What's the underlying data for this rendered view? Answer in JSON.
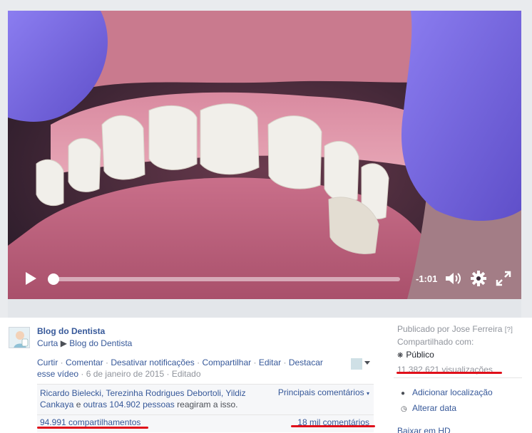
{
  "video": {
    "time_remaining": "-1:01",
    "progress": 0.0
  },
  "post": {
    "page_name": "Blog do Dentista",
    "curta": "Curta",
    "arrow": "▶",
    "curta_target": "Blog do Dentista",
    "actions": {
      "like": "Curtir",
      "comment": "Comentar",
      "disable_notifications": "Desativar notificações",
      "share": "Compartilhar",
      "edit": "Editar",
      "highlight": "Destacar esse vídeo",
      "date": "6 de janeiro de 2015",
      "edited": "Editado",
      "sep": " · "
    },
    "reactions": {
      "people": "Ricardo Bielecki, Terezinha Rodrigues Debortoli, Yildiz Cankaya",
      "and": " e ",
      "others": "outras 104.902 pessoas",
      "reacted": " reagiram a isso.",
      "top_comments": "Principais comentários",
      "shares": "94.991 compartilhamentos",
      "comments": "18 mil comentários"
    }
  },
  "sidebar": {
    "published_by": "Publicado por Jose Ferreira",
    "help": "[?]",
    "shared_with": "Compartilhado com:",
    "audience": "Público",
    "views": "11.382.621 visualizações",
    "add_location": "Adicionar localização",
    "change_date": "Alterar data",
    "download_hd": "Baixar em HD"
  },
  "colors": {
    "link": "#365899",
    "annotation_red": "#e0101a",
    "glove": "#7d6fe0"
  }
}
